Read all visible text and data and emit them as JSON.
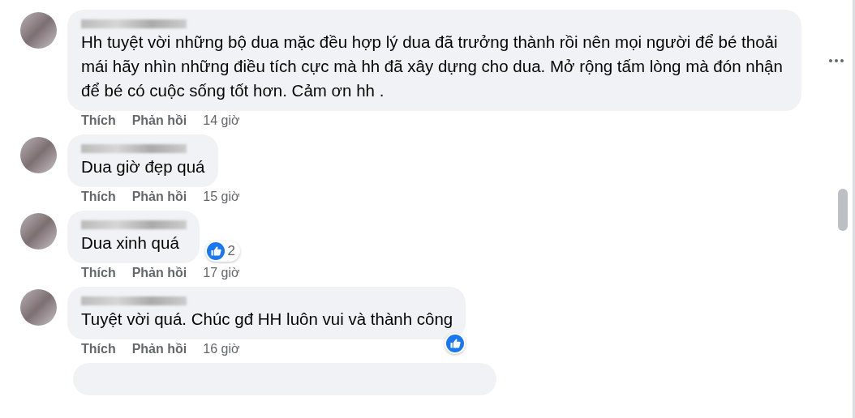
{
  "comments": [
    {
      "text": "Hh tuyệt vời những bộ dua mặc đều hợp lý dua đã trưởng thành rồi nên mọi người để bé thoải mái hãy nhìn những điều tích cực mà hh đã xây dựng cho dua. Mở rộng tấm lòng mà đón nhận để bé có cuộc sống tốt hơn. Cảm ơn hh .",
      "like": "Thích",
      "reply": "Phản hồi",
      "time": "14 giờ",
      "has_reaction": false,
      "menu": true
    },
    {
      "text": "Dua giờ đẹp quá",
      "like": "Thích",
      "reply": "Phản hồi",
      "time": "15 giờ",
      "has_reaction": false,
      "menu": false
    },
    {
      "text": "Dua xinh quá",
      "like": "Thích",
      "reply": "Phản hồi",
      "time": "17 giờ",
      "has_reaction": true,
      "reaction_count": "2",
      "menu": false
    },
    {
      "text": "Tuyệt vời quá. Chúc gđ HH luôn vui và thành công",
      "like": "Thích",
      "reply": "Phản hồi",
      "time": "16 giờ",
      "has_reaction": true,
      "menu": false
    }
  ]
}
